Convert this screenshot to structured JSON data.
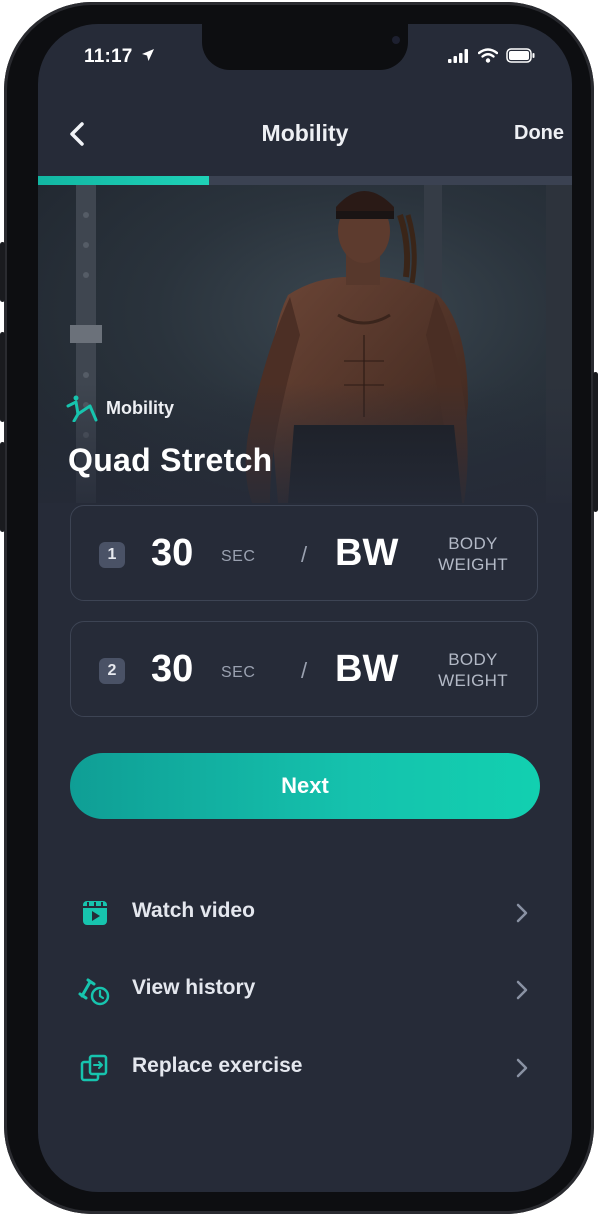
{
  "status_bar": {
    "time": "11:17"
  },
  "nav": {
    "back_icon": "chevron-left-icon",
    "title": "Mobility",
    "done_label": "Done"
  },
  "progress": {
    "fraction": 0.32
  },
  "exercise": {
    "category_icon": "mobility-icon",
    "category": "Mobility",
    "title": "Quad Stretch"
  },
  "sets": [
    {
      "number": "1",
      "value": "30",
      "unit": "SEC",
      "separator": "/",
      "weight": "BW",
      "weight_unit_line1": "BODY",
      "weight_unit_line2": "WEIGHT"
    },
    {
      "number": "2",
      "value": "30",
      "unit": "SEC",
      "separator": "/",
      "weight": "BW",
      "weight_unit_line1": "BODY",
      "weight_unit_line2": "WEIGHT"
    }
  ],
  "next_label": "Next",
  "menu": [
    {
      "icon": "video-icon",
      "label": "Watch video"
    },
    {
      "icon": "history-icon",
      "label": "View history"
    },
    {
      "icon": "replace-icon",
      "label": "Replace exercise"
    }
  ],
  "colors": {
    "accent": "#15c2ad",
    "background": "#262b38",
    "card_border": "#3d4454"
  }
}
